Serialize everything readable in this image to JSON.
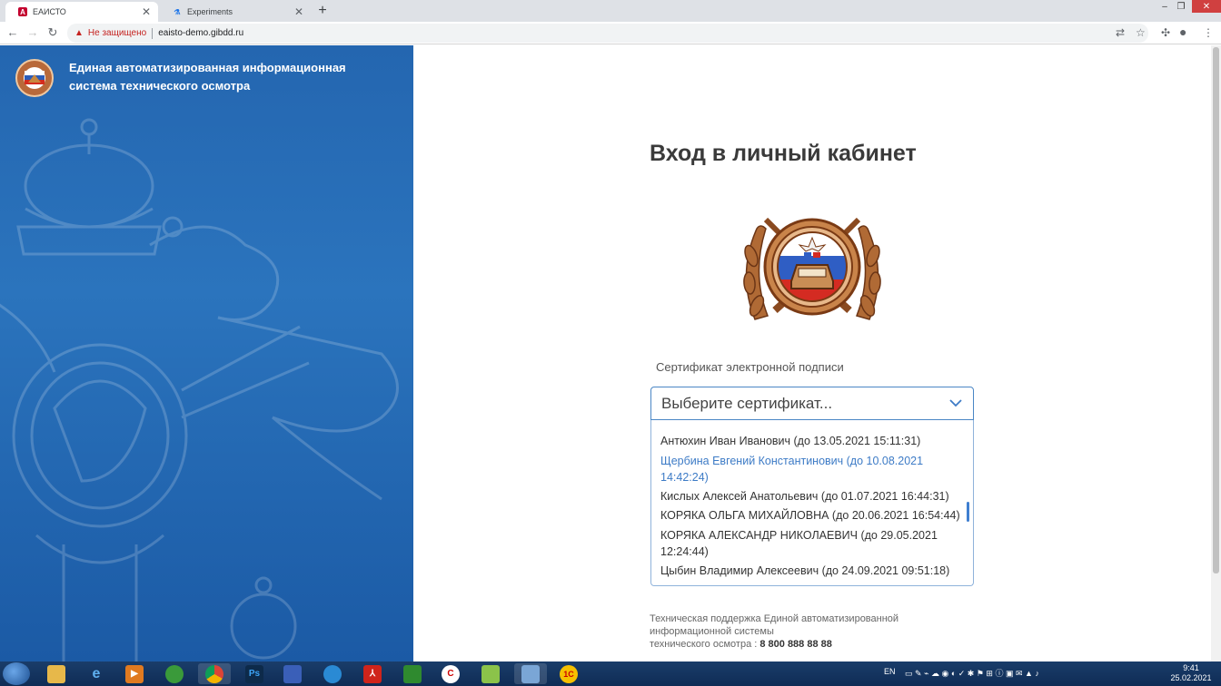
{
  "browser": {
    "tabs": [
      {
        "title": "ЕАИСТО",
        "active": true
      },
      {
        "title": "Experiments",
        "active": false
      }
    ],
    "security_label": "Не защищено",
    "url": "eaisto-demo.gibdd.ru"
  },
  "sidebar": {
    "title_line1": "Единая автоматизированная информационная",
    "title_line2": "система технического осмотра"
  },
  "login": {
    "heading": "Вход в личный кабинет",
    "cert_label": "Сертификат электронной подписи",
    "select_placeholder": "Выберите сертификат...",
    "options": [
      {
        "line1": "Антюхин Иван Иванович (до 13.05.2021 15:11:31)",
        "line2": ""
      },
      {
        "line1": "Щербина Евгений Константинович (до 10.08.2021",
        "line2": "14:42:24)"
      },
      {
        "line1": "Кислых Алексей Анатольевич (до 01.07.2021 16:44:31)",
        "line2": ""
      },
      {
        "line1": "КОРЯКА ОЛЬГА МИХАЙЛОВНА (до 20.06.2021 16:54:44)",
        "line2": ""
      },
      {
        "line1": "КОРЯКА АЛЕКСАНДР НИКОЛАЕВИЧ (до 29.05.2021",
        "line2": "12:24:44)"
      },
      {
        "line1": "Цыбин Владимир Алексеевич (до 24.09.2021 09:51:18)",
        "line2": ""
      }
    ],
    "highlighted_option": 1,
    "support_line1": "Техническая поддержка Единой автоматизированной",
    "support_line2": "информационной системы",
    "support_line3": "технического осмотра : ",
    "support_phone": "8 800 888 88 88"
  },
  "taskbar": {
    "language": "EN",
    "time": "9:41",
    "date": "25.02.2021"
  },
  "colors": {
    "sidebar_blue": "#2466b0",
    "select_border": "#4a86c5",
    "highlight_text": "#3d7bc6",
    "insecure_red": "#c5221f"
  }
}
